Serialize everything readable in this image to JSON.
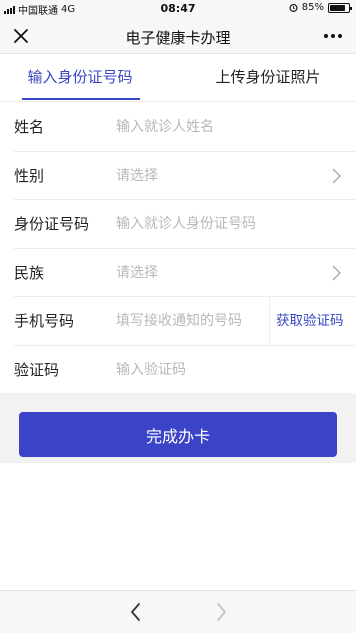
{
  "status_bar": {
    "carrier": "中国联通",
    "network": "4G",
    "time": "08:47",
    "battery": "85%",
    "battery_level": 0.85
  },
  "nav": {
    "title": "电子健康卡办理"
  },
  "tabs": [
    {
      "label": "输入身份证号码",
      "active": true
    },
    {
      "label": "上传身份证照片",
      "active": false
    }
  ],
  "form": {
    "name": {
      "label": "姓名",
      "placeholder": "输入就诊人姓名",
      "value": ""
    },
    "gender": {
      "label": "性别",
      "placeholder": "请选择"
    },
    "id_number": {
      "label": "身份证号码",
      "placeholder": "输入就诊人身份证号码",
      "value": ""
    },
    "ethnicity": {
      "label": "民族",
      "placeholder": "请选择"
    },
    "phone": {
      "label": "手机号码",
      "placeholder": "填写接收通知的号码",
      "value": "",
      "get_code_label": "获取验证码"
    },
    "code": {
      "label": "验证码",
      "placeholder": "输入验证码",
      "value": ""
    }
  },
  "submit_label": "完成办卡",
  "colors": {
    "accent": "#3a45c4",
    "button": "#3b43c7",
    "placeholder": "#b8b8b8"
  },
  "icons": {
    "close": "close-icon",
    "more": "more-icon",
    "chevron": "chevron-right-icon",
    "back": "back-icon",
    "forward": "forward-icon"
  }
}
